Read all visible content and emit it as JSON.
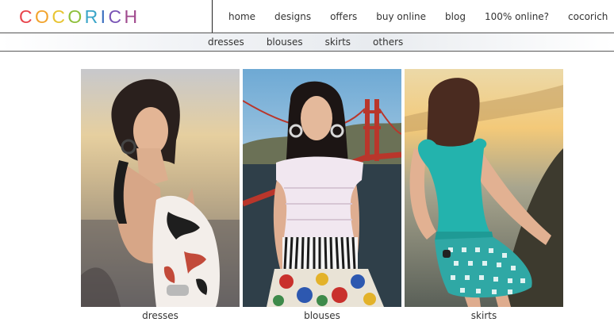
{
  "brand": {
    "logo_letters": [
      {
        "char": "C",
        "color": "#e8434b"
      },
      {
        "char": "O",
        "color": "#f2a32c"
      },
      {
        "char": "C",
        "color": "#e8c431"
      },
      {
        "char": "O",
        "color": "#8dbf3a"
      },
      {
        "char": "R",
        "color": "#3aa5c8"
      },
      {
        "char": "I",
        "color": "#3b6fc0"
      },
      {
        "char": "C",
        "color": "#7a55b6"
      },
      {
        "char": "H",
        "color": "#a04a8e"
      }
    ]
  },
  "nav": {
    "items": [
      "home",
      "designs",
      "offers",
      "buy online",
      "blog",
      "100% online?",
      "cocorich"
    ]
  },
  "subnav": {
    "items": [
      "dresses",
      "blouses",
      "skirts",
      "others"
    ]
  },
  "gallery": [
    {
      "caption": "dresses"
    },
    {
      "caption": "blouses"
    },
    {
      "caption": "skirts"
    }
  ]
}
